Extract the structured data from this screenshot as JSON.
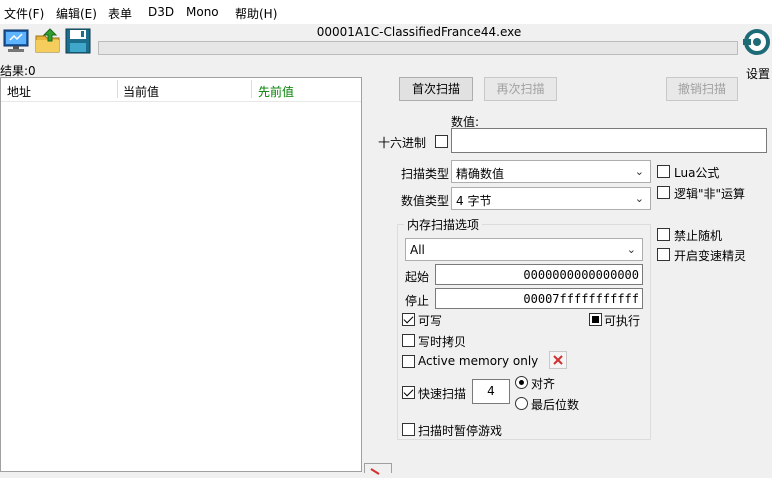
{
  "menu": [
    "文件(F)",
    "编辑(E)",
    "表单",
    "D3D",
    "Mono",
    "帮助(H)"
  ],
  "process_title": "00001A1C-ClassifiedFrance44.exe",
  "settings_label": "设置",
  "results_label": "结果:0",
  "columns": {
    "address": "地址",
    "current": "当前值",
    "previous": "先前值"
  },
  "colors": {
    "previous_col": "#008000",
    "delete_x": "#d32f2f"
  },
  "buttons": {
    "first_scan": "首次扫描",
    "next_scan": "再次扫描",
    "undo_scan": "撤销扫描"
  },
  "value_label": "数值:",
  "hex_label": "十六进制",
  "value_input": "",
  "scan_type_label": "扫描类型",
  "scan_type_value": "精确数值",
  "value_type_label": "数值类型",
  "value_type_value": "4 字节",
  "lua_formula": "Lua公式",
  "logic_not": "逻辑\"非\"运算",
  "disable_random": "禁止随机",
  "speedhack": "开启变速精灵",
  "mem_options_title": "内存扫描选项",
  "mem_region": "All",
  "start_label": "起始",
  "start_value": "0000000000000000",
  "stop_label": "停止",
  "stop_value": "00007fffffffffff",
  "writable": "可写",
  "executable": "可执行",
  "copy_on_write": "写时拷贝",
  "active_memory": "Active memory only",
  "fast_scan": "快速扫描",
  "fast_scan_value": "4",
  "align": "对齐",
  "last_digits": "最后位数",
  "pause_game": "扫描时暂停游戏",
  "icons": [
    "computer-icon",
    "open-folder-icon",
    "save-icon",
    "settings-icon",
    "delete-x-icon"
  ]
}
